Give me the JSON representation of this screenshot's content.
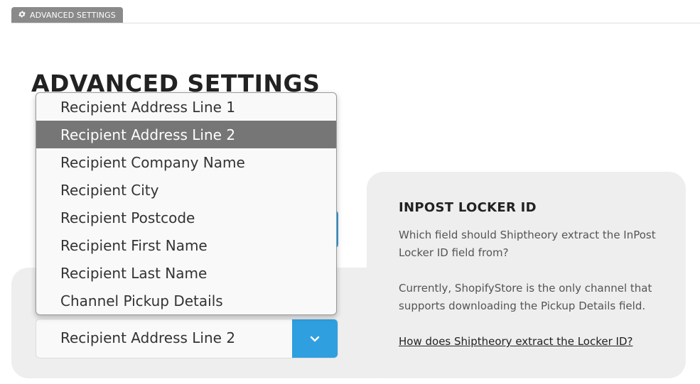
{
  "tab": {
    "label": "ADVANCED SETTINGS",
    "icon": "gear-icon"
  },
  "page": {
    "title": "ADVANCED SETTINGS"
  },
  "select": {
    "value": "Recipient Address Line 2",
    "button_icon": "chevron-down-icon",
    "accent_color": "#2f9fe0"
  },
  "dropdown": {
    "options": [
      {
        "label": "Recipient Address Line 1",
        "selected": false
      },
      {
        "label": "Recipient Address Line 2",
        "selected": true
      },
      {
        "label": "Recipient Company Name",
        "selected": false
      },
      {
        "label": "Recipient City",
        "selected": false
      },
      {
        "label": "Recipient Postcode",
        "selected": false
      },
      {
        "label": "Recipient First Name",
        "selected": false
      },
      {
        "label": "Recipient Last Name",
        "selected": false
      },
      {
        "label": "Channel Pickup Details",
        "selected": false
      }
    ],
    "highlight_color": "#767676"
  },
  "info": {
    "title": "INPOST LOCKER ID",
    "paragraph1": "Which field should Shiptheory extract the InPost Locker ID field from?",
    "paragraph2": "Currently, ShopifyStore is the only channel that supports downloading the Pickup Details field.",
    "link": "How does Shiptheory extract the Locker ID?"
  }
}
